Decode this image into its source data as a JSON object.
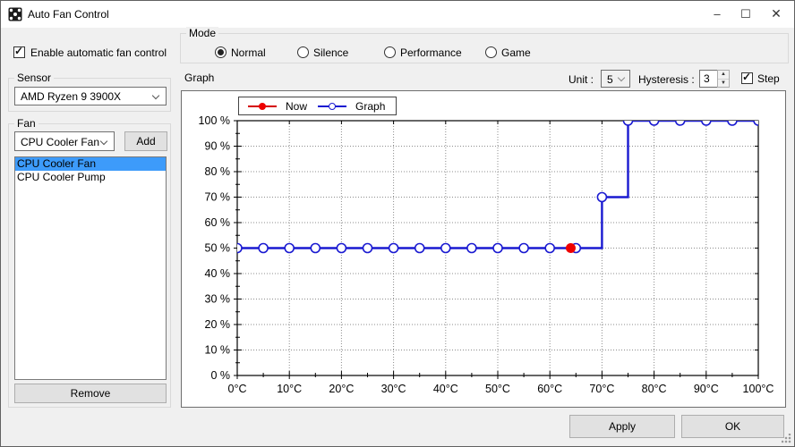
{
  "window": {
    "title": "Auto Fan Control",
    "minimize_glyph": "–",
    "maximize_glyph": "☐",
    "close_glyph": "✕"
  },
  "left_panel": {
    "enable_checkbox": {
      "label": "Enable automatic fan control",
      "checked": true,
      "check_glyph": "✓"
    },
    "sensor_group": {
      "label": "Sensor",
      "dropdown_value": "AMD Ryzen 9 3900X"
    },
    "fan_group": {
      "label": "Fan",
      "dropdown_value": "CPU Cooler Fan",
      "add_button": "Add",
      "list_items": [
        {
          "label": "CPU Cooler Fan",
          "selected": true
        },
        {
          "label": "CPU Cooler Pump",
          "selected": false
        }
      ],
      "remove_button": "Remove"
    }
  },
  "mode_group": {
    "label": "Mode",
    "options": [
      {
        "label": "Normal",
        "selected": true
      },
      {
        "label": "Silence",
        "selected": false
      },
      {
        "label": "Performance",
        "selected": false
      },
      {
        "label": "Game",
        "selected": false
      }
    ]
  },
  "graph_section": {
    "label": "Graph",
    "unit": {
      "label": "Unit :",
      "value": "5"
    },
    "hysteresis": {
      "label": "Hysteresis :",
      "value": "3",
      "up_glyph": "▲",
      "down_glyph": "▼"
    },
    "step_checkbox": {
      "label": "Step",
      "checked": true,
      "check_glyph": "✓"
    },
    "legend": {
      "now": "Now",
      "graph": "Graph"
    }
  },
  "footer": {
    "apply_button": "Apply",
    "ok_button": "OK"
  },
  "chart_data": {
    "type": "line",
    "step_mode": true,
    "xlim": [
      0,
      100
    ],
    "ylim": [
      0,
      100
    ],
    "x_major_step": 10,
    "x_minor_step": 5,
    "y_major_step": 10,
    "y_minor_step": 5,
    "grid": true,
    "grid_color": "#8c8c8c",
    "axis_color": "#000000",
    "x": [
      0,
      5,
      10,
      15,
      20,
      25,
      30,
      35,
      40,
      45,
      50,
      55,
      60,
      65,
      70,
      75,
      80,
      85,
      90,
      95,
      100
    ],
    "series": [
      {
        "name": "Graph",
        "color": "#1a1ad1",
        "marker": "open-circle",
        "values": [
          50,
          50,
          50,
          50,
          50,
          50,
          50,
          50,
          50,
          50,
          50,
          50,
          50,
          50,
          70,
          100,
          100,
          100,
          100,
          100,
          100
        ]
      }
    ],
    "now_point": {
      "name": "Now",
      "x": 64,
      "y": 50,
      "color": "#ee0000"
    },
    "x_tick_labels": [
      "0°C",
      "10°C",
      "20°C",
      "30°C",
      "40°C",
      "50°C",
      "60°C",
      "70°C",
      "80°C",
      "90°C",
      "100°C"
    ],
    "y_tick_labels": [
      "0 %",
      "10 %",
      "20 %",
      "30 %",
      "40 %",
      "50 %",
      "60 %",
      "70 %",
      "80 %",
      "90 %",
      "100 %"
    ],
    "legend_position": "top-left"
  }
}
